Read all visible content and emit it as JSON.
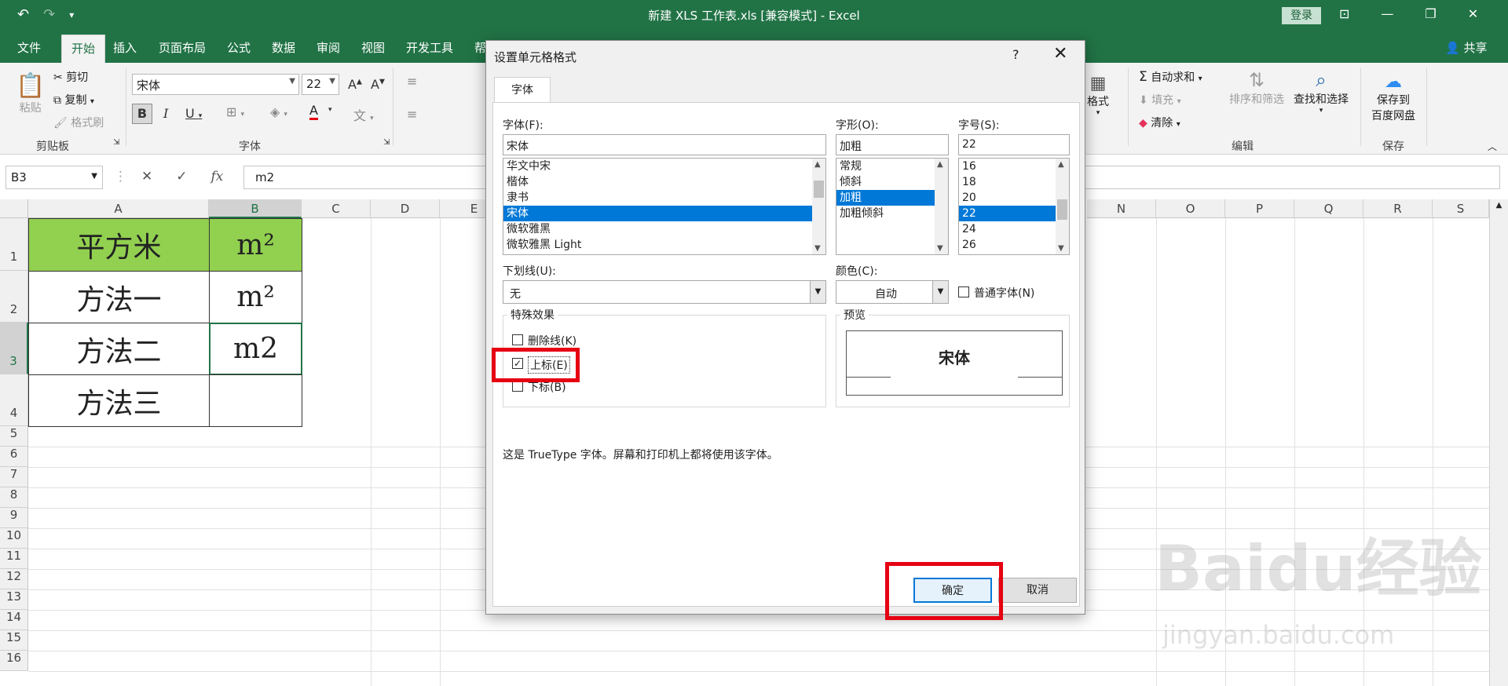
{
  "titlebar": {
    "title": "新建 XLS 工作表.xls  [兼容模式]  -  Excel",
    "login": "登录"
  },
  "tabs": [
    "文件",
    "开始",
    "插入",
    "页面布局",
    "公式",
    "数据",
    "审阅",
    "视图",
    "开发工具",
    "帮"
  ],
  "active_tab": "开始",
  "share": "共享",
  "ribbon": {
    "clipboard": {
      "paste": "粘贴",
      "cut": "剪切",
      "copy": "复制",
      "format_painter": "格式刷",
      "group_label": "剪贴板"
    },
    "font": {
      "name": "宋体",
      "size": "22",
      "group_label": "字体"
    },
    "cells": {
      "format": "格式"
    },
    "editing": {
      "autosum": "自动求和",
      "fill": "填充",
      "clear": "清除",
      "sort_filter": "排序和筛选",
      "find_select": "查找和选择",
      "group_label": "编辑"
    },
    "save": {
      "save_to": "保存到",
      "baidu_disk": "百度网盘",
      "group_label": "保存"
    }
  },
  "formula_bar": {
    "name_box": "B3",
    "value": "m2"
  },
  "columns": [
    "A",
    "B",
    "C",
    "D",
    "E",
    "N",
    "O",
    "P",
    "Q",
    "R",
    "S"
  ],
  "rows": [
    "1",
    "2",
    "3",
    "4",
    "5",
    "6",
    "7",
    "8",
    "9",
    "10",
    "11",
    "12",
    "13",
    "14",
    "15",
    "16"
  ],
  "cells": {
    "a1": "平方米",
    "b1": "m²",
    "a2": "方法一",
    "b2": "m²",
    "a3": "方法二",
    "b3": "m2",
    "a4": "方法三",
    "b4": ""
  },
  "dialog": {
    "title": "设置单元格格式",
    "help": "?",
    "tab": "字体",
    "font_label": "字体(F):",
    "font_value": "宋体",
    "fonts": [
      "华文中宋",
      "楷体",
      "隶书",
      "宋体",
      "微软雅黑",
      "微软雅黑 Light"
    ],
    "style_label": "字形(O):",
    "style_value": "加粗",
    "styles": [
      "常规",
      "倾斜",
      "加粗",
      "加粗倾斜"
    ],
    "size_label": "字号(S):",
    "size_value": "22",
    "sizes": [
      "16",
      "18",
      "20",
      "22",
      "24",
      "26"
    ],
    "underline_label": "下划线(U):",
    "underline_value": "无",
    "color_label": "颜色(C):",
    "color_value": "自动",
    "normal_font": "普通字体(N)",
    "effects_label": "特殊效果",
    "strikethrough": "删除线(K)",
    "superscript": "上标(E)",
    "subscript": "下标(B)",
    "preview_label": "预览",
    "preview_text": "宋体",
    "info": "这是 TrueType 字体。屏幕和打印机上都将使用该字体。",
    "ok": "确定",
    "cancel": "取消"
  },
  "watermark": {
    "brand": "Baidu经验",
    "url": "jingyan.baidu.com"
  },
  "colors": {
    "excel_green": "#217346",
    "cell_green": "#92d050",
    "highlight_red": "#e60012",
    "select_blue": "#0078d7"
  }
}
